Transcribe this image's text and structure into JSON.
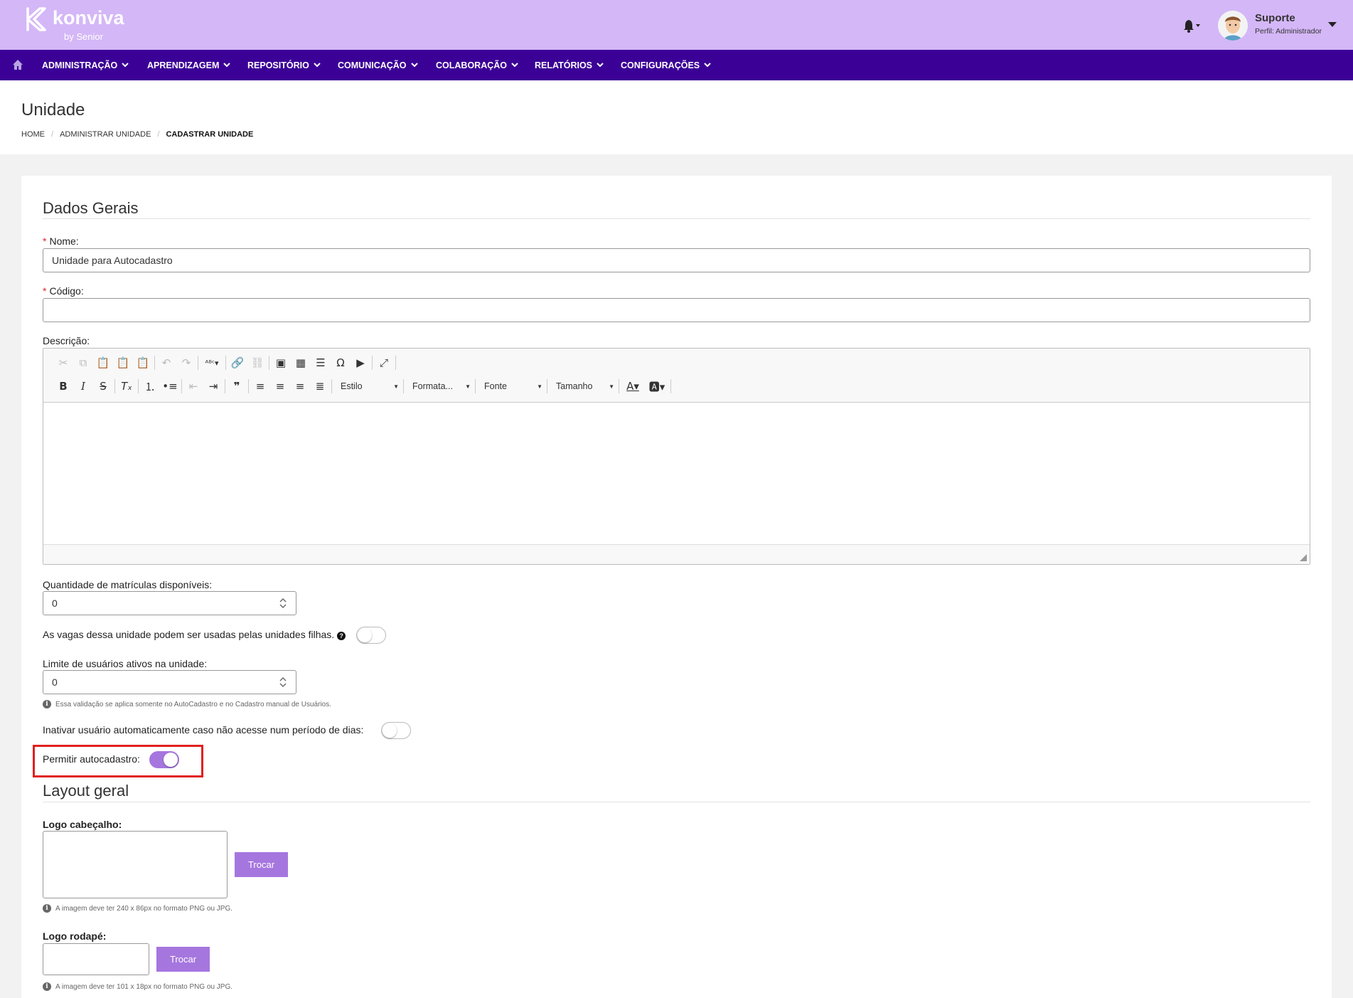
{
  "header": {
    "logo_name": "konviva",
    "logo_by": "by Senior",
    "user_name": "Suporte",
    "user_profile": "Perfil: Administrador",
    "brand_color": "#d4b7f7"
  },
  "nav": {
    "color": "#3b0196",
    "items": [
      {
        "label": "ADMINISTRAÇÃO"
      },
      {
        "label": "APRENDIZAGEM"
      },
      {
        "label": "REPOSITÓRIO"
      },
      {
        "label": "COMUNICAÇÃO"
      },
      {
        "label": "COLABORAÇÃO"
      },
      {
        "label": "RELATÓRIOS"
      },
      {
        "label": "CONFIGURAÇÕES"
      }
    ]
  },
  "page": {
    "title": "Unidade",
    "breadcrumb": [
      "HOME",
      "ADMINISTRAR UNIDADE",
      "CADASTRAR UNIDADE"
    ]
  },
  "form": {
    "section_general": "Dados Gerais",
    "nome_label": "Nome:",
    "nome_value": "Unidade para Autocadastro",
    "codigo_label": "Código:",
    "codigo_value": "",
    "descricao_label": "Descrição:",
    "editor": {
      "combo_estilo": "Estilo",
      "combo_formatacao": "Formata...",
      "combo_fonte": "Fonte",
      "combo_tamanho": "Tamanho"
    },
    "qtd_label": "Quantidade de matrículas disponíveis:",
    "qtd_value": "0",
    "vagas_label": "As vagas dessa unidade podem ser usadas pelas unidades filhas.",
    "vagas_toggle": false,
    "limite_label": "Limite de usuários ativos na unidade:",
    "limite_value": "0",
    "limite_hint": "Essa validação se aplica somente no AutoCadastro e no Cadastro manual de Usuários.",
    "inativar_label": "Inativar usuário automaticamente caso não acesse num período de dias:",
    "inativar_toggle": false,
    "autocadastro_label": "Permitir autocadastro:",
    "autocadastro_toggle": true,
    "accent_color": "#a676df",
    "highlight_color": "#e1201e"
  },
  "layout": {
    "section_title": "Layout geral",
    "logo_header_label": "Logo cabeçalho:",
    "logo_header_button": "Trocar",
    "logo_header_hint": "A imagem deve ter 240 x 86px no formato PNG ou JPG.",
    "logo_footer_label": "Logo rodapé:",
    "logo_footer_button": "Trocar",
    "logo_footer_hint": "A imagem deve ter 101 x 18px no formato PNG ou JPG."
  }
}
